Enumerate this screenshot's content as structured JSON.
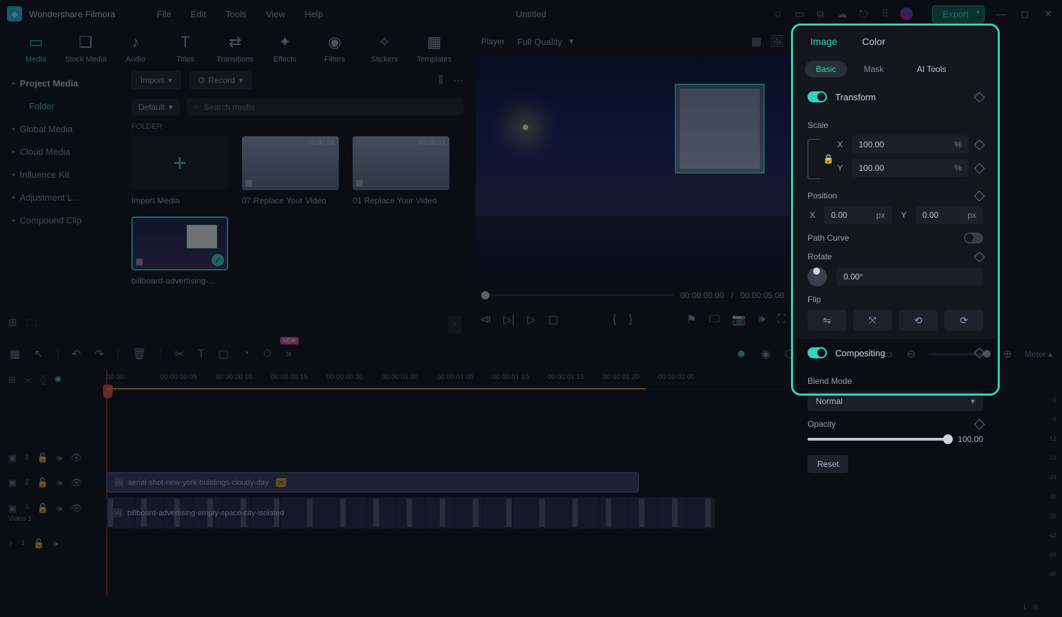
{
  "app": {
    "name": "Wondershare Filmora",
    "document": "Untitled"
  },
  "menu": {
    "file": "File",
    "edit": "Edit",
    "tools": "Tools",
    "view": "View",
    "help": "Help"
  },
  "export_label": "Export",
  "top_tabs": {
    "media": "Media",
    "stock": "Stock Media",
    "audio": "Audio",
    "titles": "Titles",
    "transitions": "Transitions",
    "effects": "Effects",
    "filters": "Filters",
    "stickers": "Stickers",
    "templates": "Templates"
  },
  "media_nav": {
    "project": "Project Media",
    "folder": "Folder",
    "global": "Global Media",
    "cloud": "Cloud Media",
    "influence": "Influence Kit",
    "adjustment": "Adjustment L...",
    "compound": "Compound Clip"
  },
  "media_toolbar": {
    "import": "Import",
    "record": "Record",
    "default": "Default",
    "search_ph": "Search media",
    "folder_label": "FOLDER"
  },
  "thumbs": {
    "import": "Import Media",
    "t1": {
      "cap": "07 Replace Your Video",
      "dur": "00:00:03"
    },
    "t2": {
      "cap": "01 Replace Your Video",
      "dur": "00:00:01"
    },
    "t3": {
      "cap": "billboard-advertising-..."
    }
  },
  "player": {
    "label": "Player",
    "quality": "Full Quality",
    "time_current": "00:00:00:00",
    "time_total": "00:00:05:00"
  },
  "inspector": {
    "tab_image": "Image",
    "tab_color": "Color",
    "sub_basic": "Basic",
    "sub_mask": "Mask",
    "sub_ai": "AI Tools",
    "transform": "Transform",
    "scale": "Scale",
    "x": "X",
    "y": "Y",
    "scale_x": "100.00",
    "scale_y": "100.00",
    "pct": "%",
    "position": "Position",
    "pos_x": "0.00",
    "pos_y": "0.00",
    "px": "px",
    "path_curve": "Path Curve",
    "rotate": "Rotate",
    "rotate_val": "0.00°",
    "flip": "Flip",
    "compositing": "Compositing",
    "blend_mode": "Blend Mode",
    "blend_val": "Normal",
    "opacity": "Opacity",
    "opacity_val": "100.00",
    "reset": "Reset"
  },
  "timeline": {
    "meter": "Meter",
    "ruler": [
      "00:00",
      "00:00:00:05",
      "00:00:00:10",
      "00:00:00:15",
      "00:00:00:20",
      "00:00:01:00",
      "00:00:01:05",
      "00:00:01:10",
      "00:00:01:15",
      "00:00:01:20",
      "00:00:02:00"
    ],
    "track3": "3",
    "track2": "2",
    "track1": "1",
    "video1": "Video 1",
    "audio1": "1",
    "clip_overlay": "aerial-shot-new-york-buildings-cloudy-day",
    "clip_video": "billboard-advertising-empty-space-city-isolated",
    "db": [
      "0",
      "-6",
      "-12",
      "-18",
      "-24",
      "-30",
      "-36",
      "-42",
      "-48"
    ],
    "db_label": "dB",
    "L": "L",
    "R": "R"
  }
}
